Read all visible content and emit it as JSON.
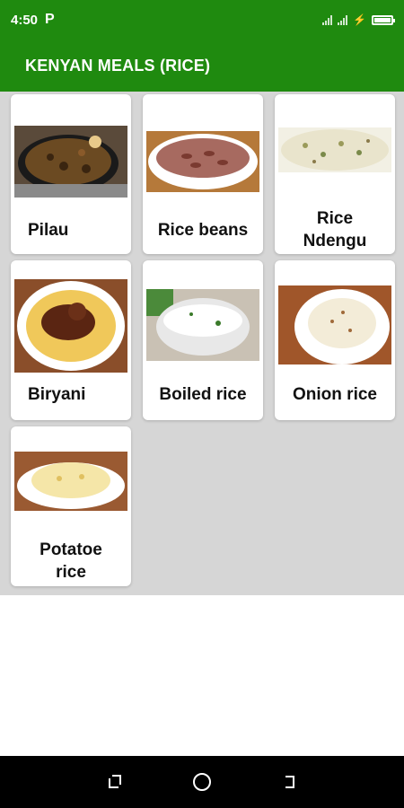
{
  "status_bar": {
    "time": "4:50",
    "app_icon": "P"
  },
  "app_bar": {
    "title": "KENYAN MEALS  (RICE)"
  },
  "meals": [
    {
      "label": "Pilau"
    },
    {
      "label": "Rice beans"
    },
    {
      "label": "Rice Ndengu"
    },
    {
      "label": "Biryani"
    },
    {
      "label": "Boiled rice"
    },
    {
      "label": "Onion rice"
    },
    {
      "label": "Potatoe rice"
    }
  ],
  "colors": {
    "primary": "#1f8a0f",
    "content_bg": "#d6d6d6"
  },
  "nav_icons": [
    "recent-apps-icon",
    "home-icon",
    "back-icon"
  ]
}
